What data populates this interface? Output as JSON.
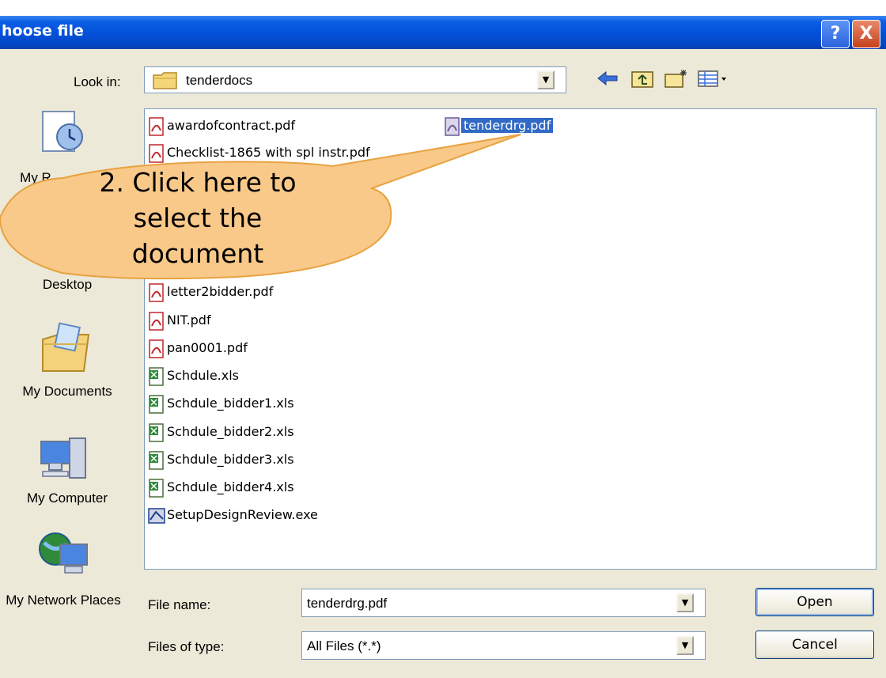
{
  "window": {
    "title": "hoose file",
    "help_glyph": "?",
    "close_glyph": "X"
  },
  "toolbar": {
    "look_in_label": "Look in:",
    "look_in_value": "tenderdocs",
    "tools": [
      "back-arrow-icon",
      "up-folder-icon",
      "new-folder-icon",
      "view-menu-icon"
    ]
  },
  "places": [
    {
      "label": "My R",
      "icon": "recent-documents-icon"
    },
    {
      "label": "Desktop",
      "icon": "desktop-icon"
    },
    {
      "label": "My Documents",
      "icon": "my-documents-icon"
    },
    {
      "label": "My Computer",
      "icon": "my-computer-icon"
    },
    {
      "label": "My Network Places",
      "icon": "network-places-icon"
    }
  ],
  "files": [
    {
      "name": "awardofcontract.pdf",
      "type": "pdf"
    },
    {
      "name": "Checklist-1865 with spl instr.pdf",
      "type": "pdf"
    },
    {
      "name": "letter2bidder.pdf",
      "type": "pdf"
    },
    {
      "name": "NIT.pdf",
      "type": "pdf"
    },
    {
      "name": "pan0001.pdf",
      "type": "pdf"
    },
    {
      "name": "Schdule.xls",
      "type": "xls"
    },
    {
      "name": "Schdule_bidder1.xls",
      "type": "xls"
    },
    {
      "name": "Schdule_bidder2.xls",
      "type": "xls"
    },
    {
      "name": "Schdule_bidder3.xls",
      "type": "xls"
    },
    {
      "name": "Schdule_bidder4.xls",
      "type": "xls"
    },
    {
      "name": "SetupDesignReview.exe",
      "type": "exe"
    },
    {
      "name": "tenderdrg.pdf",
      "type": "pdf",
      "selected": true
    }
  ],
  "filename": {
    "label": "File name:",
    "value": "tenderdrg.pdf"
  },
  "filetype": {
    "label": "Files of type:",
    "value": "All Files (*.*)"
  },
  "buttons": {
    "open": "Open",
    "cancel": "Cancel"
  },
  "callout": {
    "line1": "2. Click here to",
    "line2": "select the",
    "line3": "document"
  },
  "colors": {
    "titlebar": "#0350d8",
    "dialog_bg": "#ece9d8",
    "selection": "#316ac5",
    "callout_fill": "#f9c98a",
    "callout_border": "#e8a240"
  }
}
